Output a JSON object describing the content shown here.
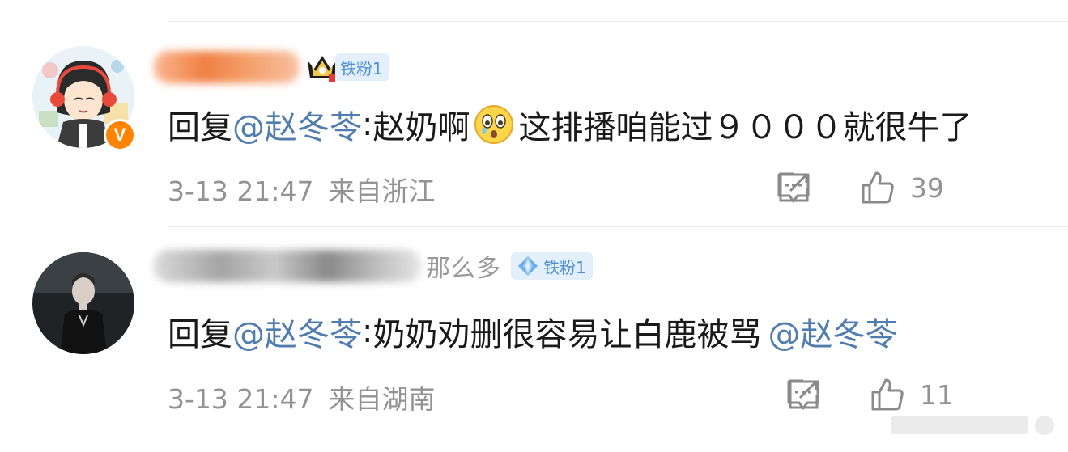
{
  "comments": [
    {
      "fan_badge": "铁粉1",
      "avatar_badge": "V",
      "text": {
        "prefix": "回复",
        "mention": "@赵冬苓",
        "colon": ":",
        "before_emoji": "赵奶啊",
        "emoji": "crying-face-emoji",
        "after_emoji": "这排播咱能过９０００就很牛了"
      },
      "time": "3-13 21:47",
      "location": "来自浙江",
      "likes": "39",
      "icons": {
        "share": "share-icon",
        "comment": "comment-icon",
        "like": "thumbs-up-icon",
        "level": "crown-icon"
      }
    },
    {
      "name_tail": "那么多",
      "fan_badge": "铁粉1",
      "text": {
        "prefix": "回复",
        "mention": "@赵冬苓",
        "colon": ":",
        "body": "奶奶劝删很容易让白鹿被骂",
        "mention2": "@赵冬苓"
      },
      "time": "3-13 21:47",
      "location": "来自湖南",
      "likes": "11",
      "icons": {
        "share": "share-icon",
        "comment": "comment-icon",
        "like": "thumbs-up-icon",
        "level": "diamond-icon"
      }
    }
  ],
  "colors": {
    "mention": "#507daf",
    "badge_bg": "#e3effb",
    "badge_text": "#4a8fd6",
    "verified": "#ff8200",
    "meta": "#939393"
  }
}
